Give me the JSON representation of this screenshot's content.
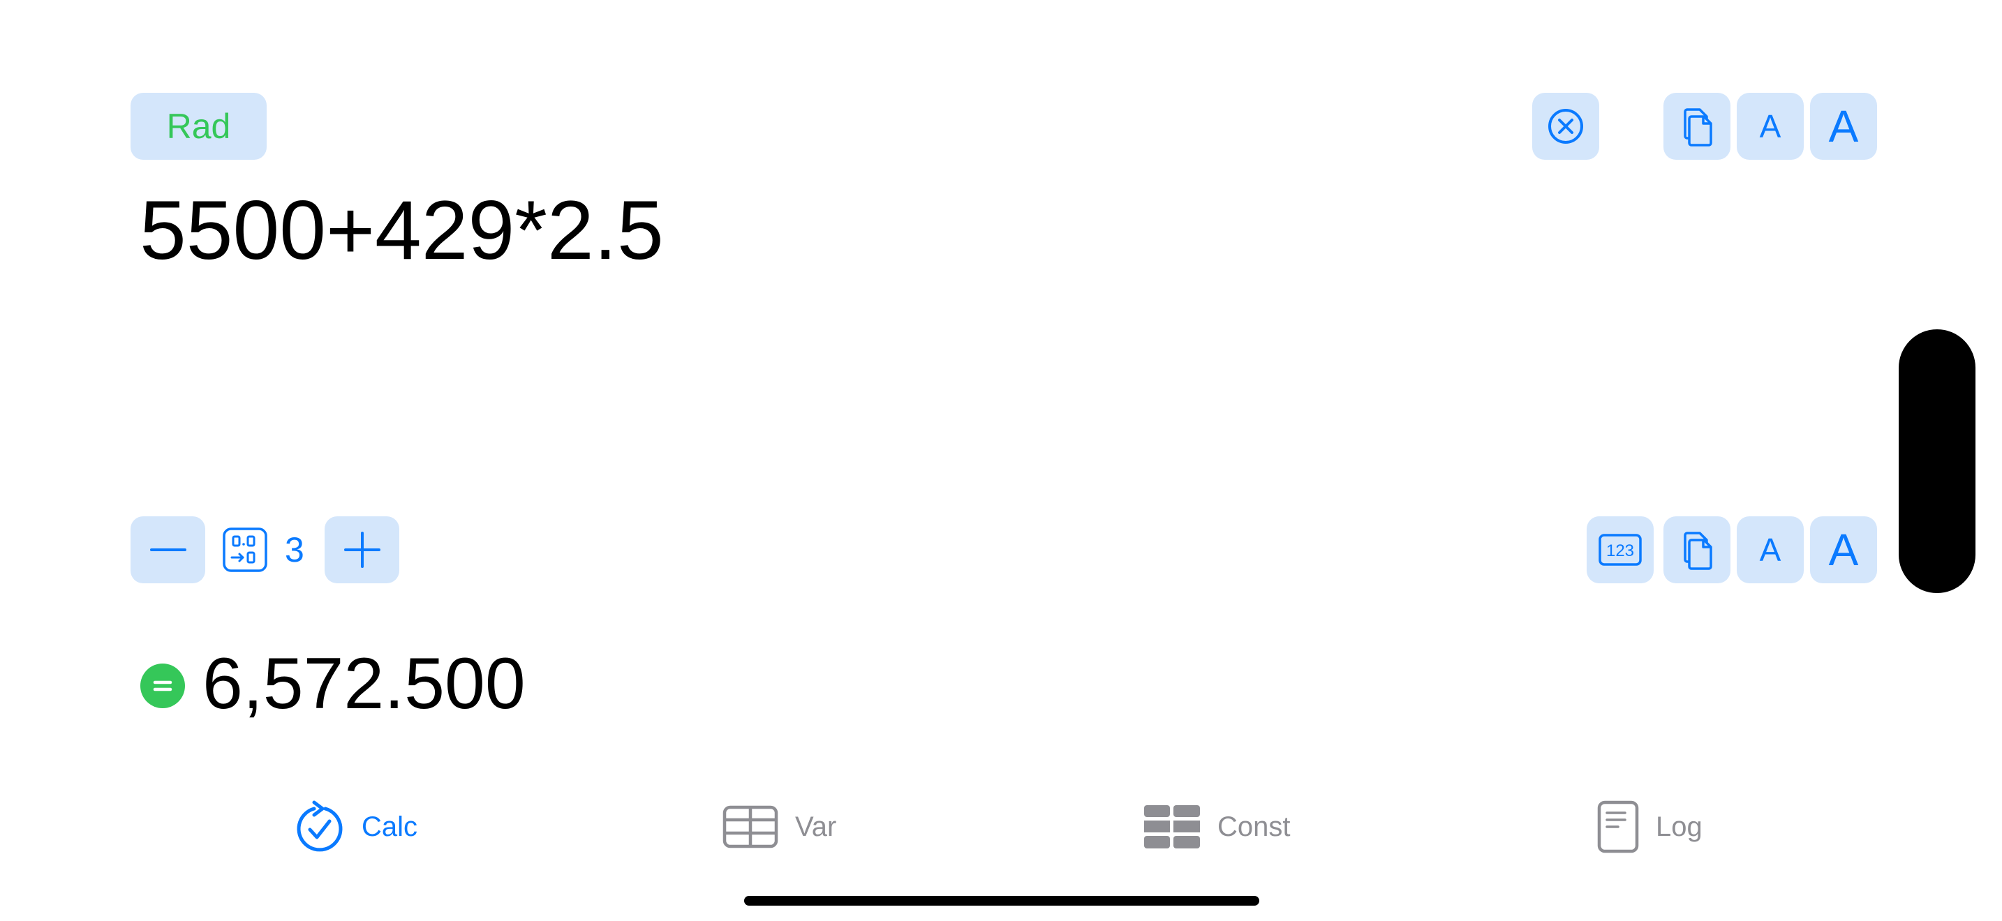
{
  "top_bar": {
    "angle_mode_label": "Rad",
    "font_small_label": "A",
    "font_large_label": "A",
    "icons": [
      "clear-icon",
      "copy-icon"
    ]
  },
  "expression": "5500+429*2.5",
  "result_bar": {
    "precision_value": "3",
    "format_icon_label": "123",
    "font_small_label": "A",
    "font_large_label": "A",
    "icons": [
      "minus-icon",
      "precision-icon",
      "plus-icon",
      "format-icon",
      "copy-icon"
    ]
  },
  "result": "6,572.500",
  "tabs": [
    {
      "label": "Calc",
      "icon": "calc-icon",
      "active": true
    },
    {
      "label": "Var",
      "icon": "var-icon",
      "active": false
    },
    {
      "label": "Const",
      "icon": "const-icon",
      "active": false
    },
    {
      "label": "Log",
      "icon": "log-icon",
      "active": false
    }
  ],
  "colors": {
    "accent": "#0a7aff",
    "button_bg": "#d4e6fb",
    "green": "#35c759",
    "inactive": "#8e8e93"
  }
}
